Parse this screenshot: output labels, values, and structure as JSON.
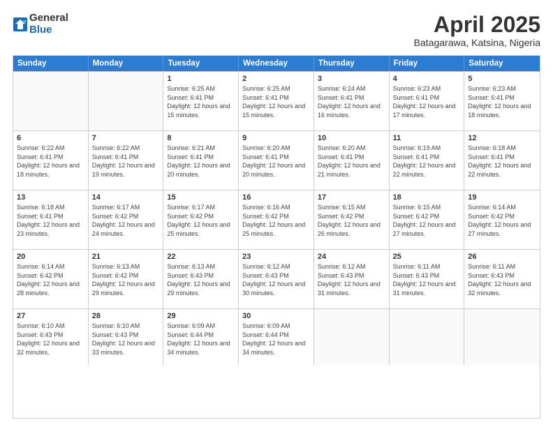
{
  "header": {
    "logo_general": "General",
    "logo_blue": "Blue",
    "month_title": "April 2025",
    "location": "Batagarawa, Katsina, Nigeria"
  },
  "weekdays": [
    "Sunday",
    "Monday",
    "Tuesday",
    "Wednesday",
    "Thursday",
    "Friday",
    "Saturday"
  ],
  "rows": [
    [
      {
        "day": "",
        "sunrise": "",
        "sunset": "",
        "daylight": ""
      },
      {
        "day": "",
        "sunrise": "",
        "sunset": "",
        "daylight": ""
      },
      {
        "day": "1",
        "sunrise": "Sunrise: 6:25 AM",
        "sunset": "Sunset: 6:41 PM",
        "daylight": "Daylight: 12 hours and 15 minutes."
      },
      {
        "day": "2",
        "sunrise": "Sunrise: 6:25 AM",
        "sunset": "Sunset: 6:41 PM",
        "daylight": "Daylight: 12 hours and 15 minutes."
      },
      {
        "day": "3",
        "sunrise": "Sunrise: 6:24 AM",
        "sunset": "Sunset: 6:41 PM",
        "daylight": "Daylight: 12 hours and 16 minutes."
      },
      {
        "day": "4",
        "sunrise": "Sunrise: 6:23 AM",
        "sunset": "Sunset: 6:41 PM",
        "daylight": "Daylight: 12 hours and 17 minutes."
      },
      {
        "day": "5",
        "sunrise": "Sunrise: 6:23 AM",
        "sunset": "Sunset: 6:41 PM",
        "daylight": "Daylight: 12 hours and 18 minutes."
      }
    ],
    [
      {
        "day": "6",
        "sunrise": "Sunrise: 6:22 AM",
        "sunset": "Sunset: 6:41 PM",
        "daylight": "Daylight: 12 hours and 18 minutes."
      },
      {
        "day": "7",
        "sunrise": "Sunrise: 6:22 AM",
        "sunset": "Sunset: 6:41 PM",
        "daylight": "Daylight: 12 hours and 19 minutes."
      },
      {
        "day": "8",
        "sunrise": "Sunrise: 6:21 AM",
        "sunset": "Sunset: 6:41 PM",
        "daylight": "Daylight: 12 hours and 20 minutes."
      },
      {
        "day": "9",
        "sunrise": "Sunrise: 6:20 AM",
        "sunset": "Sunset: 6:41 PM",
        "daylight": "Daylight: 12 hours and 20 minutes."
      },
      {
        "day": "10",
        "sunrise": "Sunrise: 6:20 AM",
        "sunset": "Sunset: 6:41 PM",
        "daylight": "Daylight: 12 hours and 21 minutes."
      },
      {
        "day": "11",
        "sunrise": "Sunrise: 6:19 AM",
        "sunset": "Sunset: 6:41 PM",
        "daylight": "Daylight: 12 hours and 22 minutes."
      },
      {
        "day": "12",
        "sunrise": "Sunrise: 6:18 AM",
        "sunset": "Sunset: 6:41 PM",
        "daylight": "Daylight: 12 hours and 22 minutes."
      }
    ],
    [
      {
        "day": "13",
        "sunrise": "Sunrise: 6:18 AM",
        "sunset": "Sunset: 6:41 PM",
        "daylight": "Daylight: 12 hours and 23 minutes."
      },
      {
        "day": "14",
        "sunrise": "Sunrise: 6:17 AM",
        "sunset": "Sunset: 6:42 PM",
        "daylight": "Daylight: 12 hours and 24 minutes."
      },
      {
        "day": "15",
        "sunrise": "Sunrise: 6:17 AM",
        "sunset": "Sunset: 6:42 PM",
        "daylight": "Daylight: 12 hours and 25 minutes."
      },
      {
        "day": "16",
        "sunrise": "Sunrise: 6:16 AM",
        "sunset": "Sunset: 6:42 PM",
        "daylight": "Daylight: 12 hours and 25 minutes."
      },
      {
        "day": "17",
        "sunrise": "Sunrise: 6:15 AM",
        "sunset": "Sunset: 6:42 PM",
        "daylight": "Daylight: 12 hours and 26 minutes."
      },
      {
        "day": "18",
        "sunrise": "Sunrise: 6:15 AM",
        "sunset": "Sunset: 6:42 PM",
        "daylight": "Daylight: 12 hours and 27 minutes."
      },
      {
        "day": "19",
        "sunrise": "Sunrise: 6:14 AM",
        "sunset": "Sunset: 6:42 PM",
        "daylight": "Daylight: 12 hours and 27 minutes."
      }
    ],
    [
      {
        "day": "20",
        "sunrise": "Sunrise: 6:14 AM",
        "sunset": "Sunset: 6:42 PM",
        "daylight": "Daylight: 12 hours and 28 minutes."
      },
      {
        "day": "21",
        "sunrise": "Sunrise: 6:13 AM",
        "sunset": "Sunset: 6:42 PM",
        "daylight": "Daylight: 12 hours and 29 minutes."
      },
      {
        "day": "22",
        "sunrise": "Sunrise: 6:13 AM",
        "sunset": "Sunset: 6:43 PM",
        "daylight": "Daylight: 12 hours and 29 minutes."
      },
      {
        "day": "23",
        "sunrise": "Sunrise: 6:12 AM",
        "sunset": "Sunset: 6:43 PM",
        "daylight": "Daylight: 12 hours and 30 minutes."
      },
      {
        "day": "24",
        "sunrise": "Sunrise: 6:12 AM",
        "sunset": "Sunset: 6:43 PM",
        "daylight": "Daylight: 12 hours and 31 minutes."
      },
      {
        "day": "25",
        "sunrise": "Sunrise: 6:11 AM",
        "sunset": "Sunset: 6:43 PM",
        "daylight": "Daylight: 12 hours and 31 minutes."
      },
      {
        "day": "26",
        "sunrise": "Sunrise: 6:11 AM",
        "sunset": "Sunset: 6:43 PM",
        "daylight": "Daylight: 12 hours and 32 minutes."
      }
    ],
    [
      {
        "day": "27",
        "sunrise": "Sunrise: 6:10 AM",
        "sunset": "Sunset: 6:43 PM",
        "daylight": "Daylight: 12 hours and 32 minutes."
      },
      {
        "day": "28",
        "sunrise": "Sunrise: 6:10 AM",
        "sunset": "Sunset: 6:43 PM",
        "daylight": "Daylight: 12 hours and 33 minutes."
      },
      {
        "day": "29",
        "sunrise": "Sunrise: 6:09 AM",
        "sunset": "Sunset: 6:44 PM",
        "daylight": "Daylight: 12 hours and 34 minutes."
      },
      {
        "day": "30",
        "sunrise": "Sunrise: 6:09 AM",
        "sunset": "Sunset: 6:44 PM",
        "daylight": "Daylight: 12 hours and 34 minutes."
      },
      {
        "day": "",
        "sunrise": "",
        "sunset": "",
        "daylight": ""
      },
      {
        "day": "",
        "sunrise": "",
        "sunset": "",
        "daylight": ""
      },
      {
        "day": "",
        "sunrise": "",
        "sunset": "",
        "daylight": ""
      }
    ]
  ]
}
